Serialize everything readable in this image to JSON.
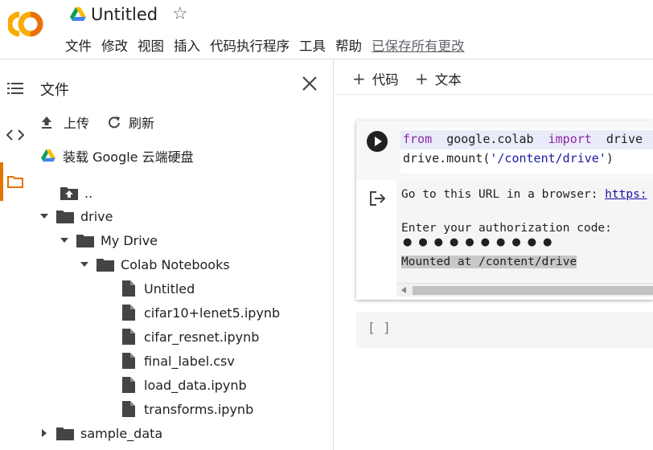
{
  "header": {
    "title": "Untitled",
    "menu": [
      "文件",
      "修改",
      "视图",
      "插入",
      "代码执行程序",
      "工具",
      "帮助"
    ],
    "save_status": "已保存所有更改"
  },
  "sidebar": {
    "title": "文件",
    "upload_label": "上传",
    "refresh_label": "刷新",
    "mount_label": "装载 Google 云端硬盘",
    "tree": [
      {
        "label": "..",
        "type": "parent"
      },
      {
        "label": "drive",
        "type": "folder",
        "expanded": true
      },
      {
        "label": "My Drive",
        "type": "folder",
        "expanded": true
      },
      {
        "label": "Colab Notebooks",
        "type": "folder",
        "expanded": true
      },
      {
        "label": "Untitled",
        "type": "file"
      },
      {
        "label": "cifar10+lenet5.ipynb",
        "type": "file"
      },
      {
        "label": "cifar_resnet.ipynb",
        "type": "file"
      },
      {
        "label": "final_label.csv",
        "type": "file"
      },
      {
        "label": "load_data.ipynb",
        "type": "file"
      },
      {
        "label": "transforms.ipynb",
        "type": "file"
      },
      {
        "label": "sample_data",
        "type": "folder",
        "expanded": false
      }
    ]
  },
  "toolbar": {
    "add_code": "代码",
    "add_text": "文本"
  },
  "cell": {
    "code_line1": {
      "kw1": "from",
      "mod": "google.colab",
      "kw2": "import",
      "name": "drive"
    },
    "code_line2": {
      "prefix": "drive.mount(",
      "arg": "'/content/drive'",
      "suffix": ")"
    },
    "output": {
      "line1_text": "Go to this URL in a browser: ",
      "line1_link": "https:",
      "line2": "Enter your authorization code:",
      "dots": "●●●●●●●●●●",
      "line4": "Mounted at /content/drive"
    }
  },
  "empty_cell": {
    "brackets": "[ ]"
  },
  "colors": {
    "accent": "#e37400",
    "link": "#1a0dab",
    "keyword": "#8e24aa"
  }
}
